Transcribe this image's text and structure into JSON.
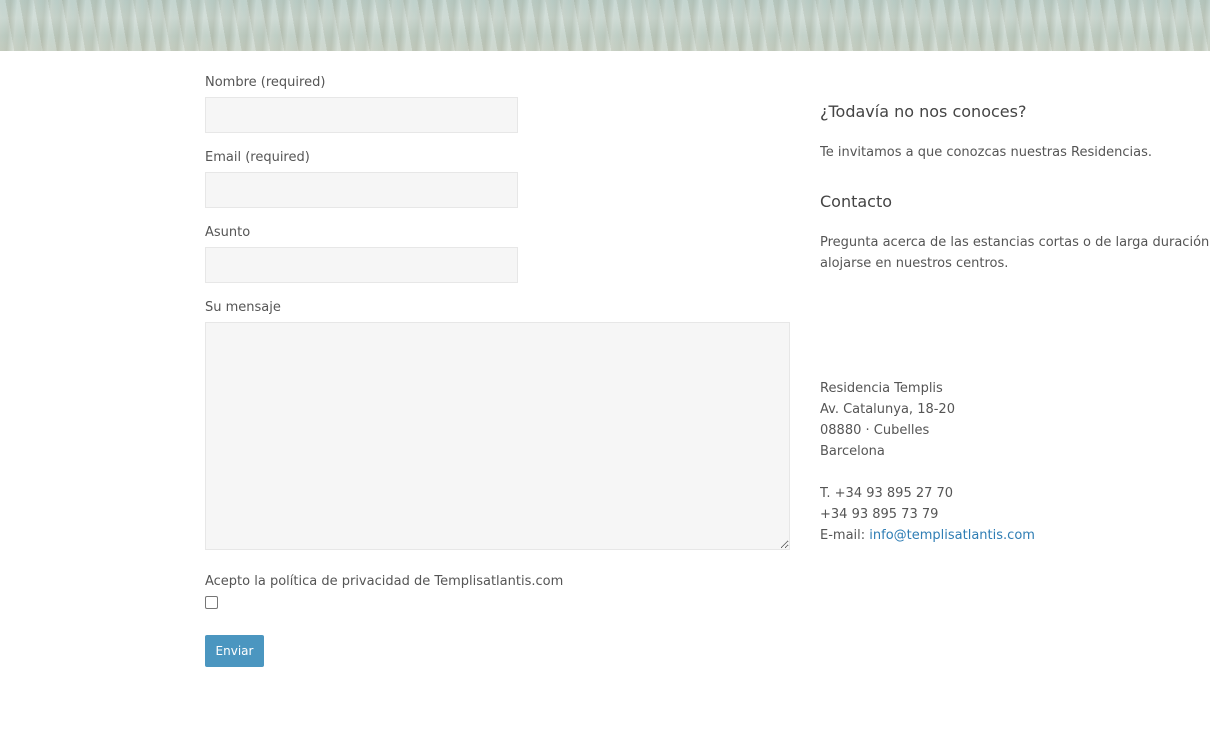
{
  "form": {
    "name_label": "Nombre (required)",
    "email_label": "Email (required)",
    "subject_label": "Asunto",
    "message_label": "Su mensaje",
    "privacy_label": "Acepto la política de privacidad de Templisatlantis.com",
    "privacy_checked": false,
    "submit_label": "Enviar"
  },
  "sidebar": {
    "intro_title": "¿Todavía no nos conoces?",
    "intro_text": "Te invitamos a que conozcas nuestras Residencias.",
    "contact_title": "Contacto",
    "contact_text_line1": "Pregunta acerca de las estancias cortas o de larga duración. Tam",
    "contact_text_line2": "alojarse en nuestros centros.",
    "address": {
      "name": "Residencia Templis",
      "street": "Av. Catalunya, 18-20",
      "city": "08880 · Cubelles",
      "region": "Barcelona"
    },
    "phone_1": "T. +34 93 895 27 70",
    "phone_2": "+34 93 895 73 79",
    "email_prefix": "E-mail:",
    "email": "info@templisatlantis.com"
  },
  "colors": {
    "button": "#4b96c0",
    "link": "#2e7db4",
    "field_bg": "#f6f6f6"
  }
}
